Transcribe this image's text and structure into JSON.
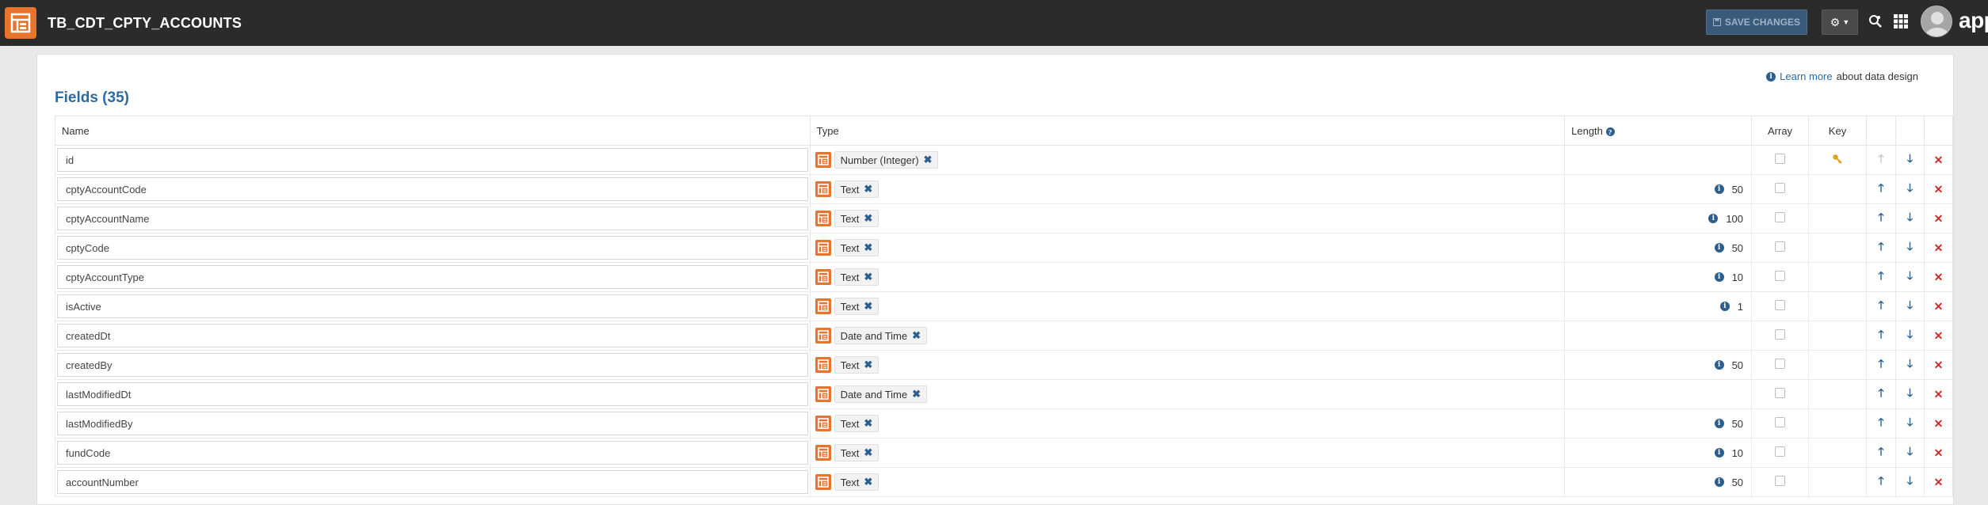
{
  "header": {
    "title": "TB_CDT_CPTY_ACCOUNTS",
    "save_label": "SAVE CHANGES",
    "brand": "app"
  },
  "learn": {
    "link": "Learn more",
    "suffix": "about data design"
  },
  "fields_title": "Fields (35)",
  "columns": {
    "name": "Name",
    "type": "Type",
    "length": "Length",
    "array": "Array",
    "key": "Key"
  },
  "rows": [
    {
      "name": "id",
      "type": "Number (Integer)",
      "length": "",
      "key": true
    },
    {
      "name": "cptyAccountCode",
      "type": "Text",
      "length": "50",
      "key": false
    },
    {
      "name": "cptyAccountName",
      "type": "Text",
      "length": "100",
      "key": false
    },
    {
      "name": "cptyCode",
      "type": "Text",
      "length": "50",
      "key": false
    },
    {
      "name": "cptyAccountType",
      "type": "Text",
      "length": "10",
      "key": false
    },
    {
      "name": "isActive",
      "type": "Text",
      "length": "1",
      "key": false
    },
    {
      "name": "createdDt",
      "type": "Date and Time",
      "length": "",
      "key": false
    },
    {
      "name": "createdBy",
      "type": "Text",
      "length": "50",
      "key": false
    },
    {
      "name": "lastModifiedDt",
      "type": "Date and Time",
      "length": "",
      "key": false
    },
    {
      "name": "lastModifiedBy",
      "type": "Text",
      "length": "50",
      "key": false
    },
    {
      "name": "fundCode",
      "type": "Text",
      "length": "10",
      "key": false
    },
    {
      "name": "accountNumber",
      "type": "Text",
      "length": "50",
      "key": false
    }
  ]
}
